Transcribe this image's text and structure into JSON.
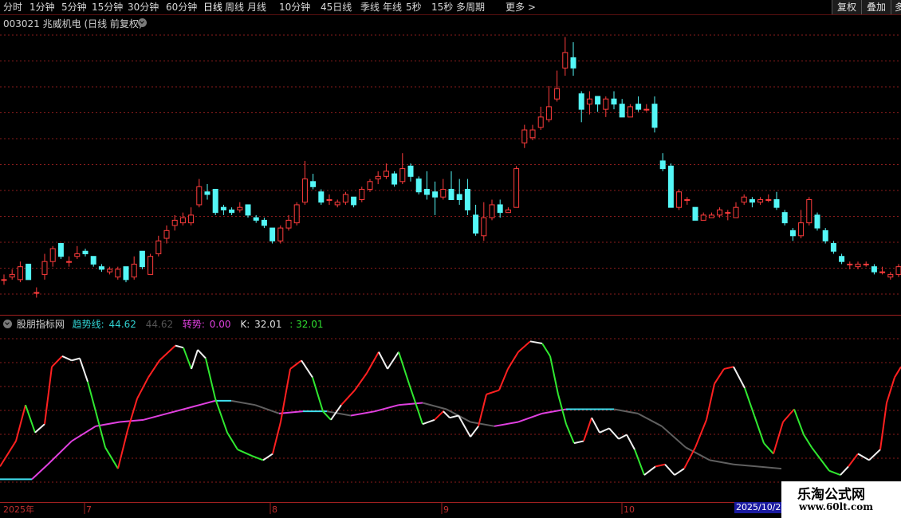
{
  "toolbar": {
    "periods": [
      "分时",
      "1分钟",
      "5分钟",
      "15分钟",
      "30分钟",
      "60分钟",
      "日线",
      "周线",
      "月线",
      "10分钟",
      "45日线",
      "季线",
      "年线",
      "5秒",
      "15秒",
      "多周期",
      "更多 >"
    ],
    "active": "日线",
    "buttons": [
      "复权",
      "叠加",
      "多"
    ]
  },
  "stock": {
    "title": "003021 兆威机电 (日线 前复权)"
  },
  "indicator": {
    "name": "股朋指标网",
    "trend_label": "趋势线:",
    "trend_value": "44.62",
    "trend_value2": "44.62",
    "turn_label": "转势:",
    "turn_value": "0.00",
    "k_label": "K:",
    "k_value": "32.01",
    "k_value2": ": 32.01"
  },
  "axis": {
    "labels": [
      "2025年",
      "7",
      "8",
      "9",
      "10"
    ],
    "current_date": "2025/10/2"
  },
  "watermark": {
    "title": "乐淘公式网",
    "url": "www.60lt.com"
  },
  "colors": {
    "up": "#ff3c3c",
    "down": "#54f7f7",
    "grid": "#8a1c1c",
    "k_up": "#ff2020",
    "k_down": "#30e830",
    "trend": "#e040e0"
  },
  "chart_data": {
    "type": "candlestick",
    "ylim": [
      0,
      1
    ],
    "candles": [
      [
        0.31,
        0.31,
        0.33,
        0.29
      ],
      [
        0.32,
        0.33,
        0.35,
        0.31
      ],
      [
        0.31,
        0.36,
        0.38,
        0.3
      ],
      [
        0.37,
        0.31,
        0.37,
        0.31
      ],
      [
        0.26,
        0.26,
        0.28,
        0.24
      ],
      [
        0.33,
        0.38,
        0.41,
        0.31
      ],
      [
        0.38,
        0.43,
        0.44,
        0.36
      ],
      [
        0.45,
        0.4,
        0.45,
        0.39
      ],
      [
        0.38,
        0.38,
        0.4,
        0.36
      ],
      [
        0.4,
        0.41,
        0.44,
        0.39
      ],
      [
        0.42,
        0.41,
        0.43,
        0.4
      ],
      [
        0.4,
        0.37,
        0.4,
        0.36
      ],
      [
        0.36,
        0.35,
        0.37,
        0.34
      ],
      [
        0.34,
        0.35,
        0.36,
        0.33
      ],
      [
        0.32,
        0.35,
        0.36,
        0.31
      ],
      [
        0.36,
        0.31,
        0.36,
        0.3
      ],
      [
        0.32,
        0.37,
        0.4,
        0.31
      ],
      [
        0.42,
        0.36,
        0.42,
        0.35
      ],
      [
        0.33,
        0.4,
        0.41,
        0.33
      ],
      [
        0.41,
        0.46,
        0.48,
        0.4
      ],
      [
        0.47,
        0.5,
        0.52,
        0.45
      ],
      [
        0.52,
        0.54,
        0.56,
        0.5
      ],
      [
        0.53,
        0.55,
        0.57,
        0.52
      ],
      [
        0.53,
        0.56,
        0.59,
        0.52
      ],
      [
        0.6,
        0.67,
        0.7,
        0.59
      ],
      [
        0.65,
        0.64,
        0.68,
        0.62
      ],
      [
        0.66,
        0.57,
        0.66,
        0.56
      ],
      [
        0.59,
        0.58,
        0.6,
        0.56
      ],
      [
        0.58,
        0.57,
        0.59,
        0.56
      ],
      [
        0.58,
        0.59,
        0.61,
        0.57
      ],
      [
        0.6,
        0.56,
        0.6,
        0.55
      ],
      [
        0.55,
        0.54,
        0.56,
        0.53
      ],
      [
        0.54,
        0.52,
        0.55,
        0.51
      ],
      [
        0.51,
        0.46,
        0.51,
        0.45
      ],
      [
        0.46,
        0.51,
        0.52,
        0.45
      ],
      [
        0.51,
        0.54,
        0.56,
        0.5
      ],
      [
        0.53,
        0.6,
        0.61,
        0.52
      ],
      [
        0.61,
        0.7,
        0.77,
        0.6
      ],
      [
        0.69,
        0.67,
        0.72,
        0.66
      ],
      [
        0.65,
        0.61,
        0.66,
        0.6
      ],
      [
        0.62,
        0.62,
        0.64,
        0.6
      ],
      [
        0.6,
        0.61,
        0.62,
        0.59
      ],
      [
        0.61,
        0.64,
        0.65,
        0.6
      ],
      [
        0.63,
        0.6,
        0.63,
        0.59
      ],
      [
        0.62,
        0.66,
        0.67,
        0.61
      ],
      [
        0.66,
        0.69,
        0.7,
        0.65
      ],
      [
        0.7,
        0.71,
        0.73,
        0.68
      ],
      [
        0.71,
        0.73,
        0.76,
        0.7
      ],
      [
        0.72,
        0.68,
        0.73,
        0.67
      ],
      [
        0.69,
        0.74,
        0.8,
        0.68
      ],
      [
        0.75,
        0.71,
        0.76,
        0.69
      ],
      [
        0.7,
        0.65,
        0.71,
        0.64
      ],
      [
        0.66,
        0.64,
        0.73,
        0.62
      ],
      [
        0.65,
        0.63,
        0.69,
        0.56
      ],
      [
        0.63,
        0.66,
        0.7,
        0.62
      ],
      [
        0.66,
        0.62,
        0.73,
        0.62
      ],
      [
        0.64,
        0.62,
        0.7,
        0.6
      ],
      [
        0.66,
        0.58,
        0.7,
        0.56
      ],
      [
        0.56,
        0.49,
        0.6,
        0.48
      ],
      [
        0.48,
        0.55,
        0.61,
        0.46
      ],
      [
        0.55,
        0.6,
        0.62,
        0.54
      ],
      [
        0.6,
        0.57,
        0.62,
        0.55
      ],
      [
        0.57,
        0.58,
        0.59,
        0.57
      ],
      [
        0.59,
        0.74,
        0.75,
        0.59
      ],
      [
        0.84,
        0.89,
        0.91,
        0.82
      ],
      [
        0.86,
        0.89,
        0.91,
        0.85
      ],
      [
        0.9,
        0.94,
        0.98,
        0.89
      ],
      [
        0.93,
        0.98,
        1.06,
        0.92
      ],
      [
        1.01,
        1.05,
        1.12,
        1.0
      ],
      [
        1.13,
        1.19,
        1.25,
        1.1
      ],
      [
        1.17,
        1.13,
        1.23,
        1.1
      ],
      [
        1.03,
        0.97,
        1.04,
        0.92
      ],
      [
        0.99,
        1.01,
        1.04,
        0.95
      ],
      [
        1.02,
        0.99,
        1.02,
        0.96
      ],
      [
        0.97,
        1.01,
        1.02,
        0.94
      ],
      [
        1.01,
        0.99,
        1.04,
        0.97
      ],
      [
        0.99,
        0.94,
        1.01,
        0.94
      ],
      [
        0.94,
        0.98,
        0.99,
        0.94
      ],
      [
        0.99,
        0.97,
        1.02,
        0.96
      ],
      [
        0.97,
        0.97,
        0.99,
        0.96
      ],
      [
        0.99,
        0.9,
        1.02,
        0.88
      ],
      [
        0.77,
        0.74,
        0.8,
        0.73
      ],
      [
        0.75,
        0.59,
        0.76,
        0.59
      ],
      [
        0.59,
        0.65,
        0.66,
        0.58
      ],
      [
        0.62,
        0.62,
        0.63,
        0.6
      ],
      [
        0.59,
        0.54,
        0.59,
        0.54
      ],
      [
        0.54,
        0.56,
        0.57,
        0.54
      ],
      [
        0.55,
        0.56,
        0.57,
        0.55
      ],
      [
        0.56,
        0.58,
        0.59,
        0.55
      ],
      [
        0.57,
        0.57,
        0.58,
        0.54
      ],
      [
        0.55,
        0.59,
        0.61,
        0.55
      ],
      [
        0.61,
        0.63,
        0.64,
        0.6
      ],
      [
        0.62,
        0.61,
        0.63,
        0.59
      ],
      [
        0.61,
        0.62,
        0.63,
        0.6
      ],
      [
        0.62,
        0.62,
        0.64,
        0.61
      ],
      [
        0.62,
        0.59,
        0.65,
        0.58
      ],
      [
        0.57,
        0.53,
        0.58,
        0.52
      ],
      [
        0.5,
        0.48,
        0.51,
        0.46
      ],
      [
        0.48,
        0.53,
        0.58,
        0.47
      ],
      [
        0.53,
        0.62,
        0.63,
        0.52
      ],
      [
        0.56,
        0.51,
        0.57,
        0.5
      ],
      [
        0.5,
        0.46,
        0.51,
        0.45
      ],
      [
        0.45,
        0.42,
        0.46,
        0.41
      ],
      [
        0.4,
        0.38,
        0.41,
        0.37
      ],
      [
        0.37,
        0.37,
        0.38,
        0.35
      ],
      [
        0.36,
        0.37,
        0.38,
        0.35
      ],
      [
        0.37,
        0.37,
        0.38,
        0.36
      ],
      [
        0.36,
        0.34,
        0.37,
        0.33
      ],
      [
        0.34,
        0.34,
        0.36,
        0.33
      ],
      [
        0.32,
        0.33,
        0.34,
        0.31
      ],
      [
        0.33,
        0.36,
        0.37,
        0.32
      ],
      [
        0.36,
        0.37,
        0.39,
        0.35
      ],
      [
        0.37,
        0.35,
        0.38,
        0.34
      ]
    ],
    "k_line": [
      [
        0,
        0.16
      ],
      [
        20,
        0.28
      ],
      [
        32,
        0.45
      ],
      [
        44,
        0.32
      ],
      [
        56,
        0.36
      ],
      [
        65,
        0.63
      ],
      [
        78,
        0.68
      ],
      [
        90,
        0.66
      ],
      [
        100,
        0.67
      ],
      [
        110,
        0.56
      ],
      [
        120,
        0.42
      ],
      [
        132,
        0.25
      ],
      [
        148,
        0.15
      ],
      [
        160,
        0.33
      ],
      [
        172,
        0.48
      ],
      [
        186,
        0.58
      ],
      [
        200,
        0.66
      ],
      [
        220,
        0.73
      ],
      [
        230,
        0.72
      ],
      [
        240,
        0.62
      ],
      [
        248,
        0.71
      ],
      [
        258,
        0.67
      ],
      [
        270,
        0.48
      ],
      [
        285,
        0.32
      ],
      [
        298,
        0.24
      ],
      [
        316,
        0.21
      ],
      [
        330,
        0.19
      ],
      [
        342,
        0.22
      ],
      [
        352,
        0.37
      ],
      [
        364,
        0.62
      ],
      [
        378,
        0.66
      ],
      [
        392,
        0.58
      ],
      [
        405,
        0.42
      ],
      [
        415,
        0.38
      ],
      [
        428,
        0.45
      ],
      [
        445,
        0.52
      ],
      [
        460,
        0.6
      ],
      [
        475,
        0.7
      ],
      [
        486,
        0.62
      ],
      [
        500,
        0.7
      ],
      [
        513,
        0.55
      ],
      [
        522,
        0.45
      ],
      [
        530,
        0.36
      ],
      [
        545,
        0.38
      ],
      [
        556,
        0.42
      ],
      [
        564,
        0.39
      ],
      [
        575,
        0.4
      ],
      [
        590,
        0.3
      ],
      [
        600,
        0.35
      ],
      [
        610,
        0.5
      ],
      [
        626,
        0.52
      ],
      [
        637,
        0.62
      ],
      [
        650,
        0.7
      ],
      [
        665,
        0.75
      ],
      [
        680,
        0.74
      ],
      [
        690,
        0.68
      ],
      [
        700,
        0.5
      ],
      [
        710,
        0.36
      ],
      [
        720,
        0.27
      ],
      [
        732,
        0.28
      ],
      [
        742,
        0.39
      ],
      [
        752,
        0.32
      ],
      [
        764,
        0.34
      ],
      [
        776,
        0.29
      ],
      [
        786,
        0.31
      ],
      [
        796,
        0.24
      ],
      [
        808,
        0.12
      ],
      [
        822,
        0.16
      ],
      [
        834,
        0.17
      ],
      [
        846,
        0.12
      ],
      [
        858,
        0.15
      ],
      [
        872,
        0.25
      ],
      [
        886,
        0.38
      ],
      [
        896,
        0.55
      ],
      [
        908,
        0.62
      ],
      [
        920,
        0.63
      ],
      [
        934,
        0.53
      ],
      [
        946,
        0.4
      ],
      [
        958,
        0.27
      ],
      [
        970,
        0.22
      ],
      [
        982,
        0.37
      ],
      [
        996,
        0.43
      ],
      [
        1008,
        0.31
      ],
      [
        1018,
        0.25
      ],
      [
        1028,
        0.2
      ],
      [
        1040,
        0.14
      ],
      [
        1054,
        0.12
      ],
      [
        1064,
        0.16
      ],
      [
        1076,
        0.22
      ],
      [
        1090,
        0.19
      ],
      [
        1104,
        0.24
      ],
      [
        1112,
        0.46
      ],
      [
        1122,
        0.58
      ],
      [
        1130,
        0.63
      ]
    ],
    "trend_line": [
      [
        0,
        0.1
      ],
      [
        40,
        0.1
      ],
      [
        60,
        0.17
      ],
      [
        90,
        0.28
      ],
      [
        120,
        0.35
      ],
      [
        150,
        0.37
      ],
      [
        180,
        0.38
      ],
      [
        210,
        0.41
      ],
      [
        240,
        0.44
      ],
      [
        270,
        0.47
      ],
      [
        290,
        0.47
      ],
      [
        320,
        0.45
      ],
      [
        350,
        0.41
      ],
      [
        380,
        0.42
      ],
      [
        410,
        0.42
      ],
      [
        440,
        0.4
      ],
      [
        470,
        0.42
      ],
      [
        500,
        0.45
      ],
      [
        530,
        0.46
      ],
      [
        560,
        0.43
      ],
      [
        590,
        0.37
      ],
      [
        620,
        0.35
      ],
      [
        650,
        0.37
      ],
      [
        680,
        0.41
      ],
      [
        710,
        0.43
      ],
      [
        740,
        0.43
      ],
      [
        770,
        0.43
      ],
      [
        800,
        0.41
      ],
      [
        830,
        0.35
      ],
      [
        860,
        0.25
      ],
      [
        890,
        0.19
      ],
      [
        920,
        0.17
      ],
      [
        950,
        0.16
      ],
      [
        980,
        0.15
      ]
    ]
  }
}
